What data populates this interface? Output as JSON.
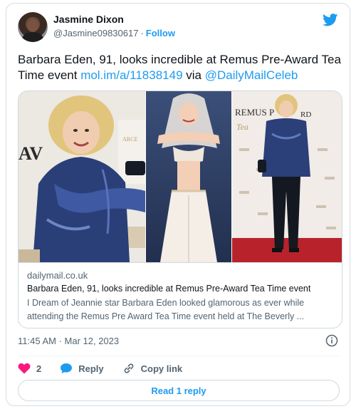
{
  "user": {
    "name": "Jasmine Dixon",
    "handle": "@Jasmine09830617",
    "follow_label": "Follow"
  },
  "tweet": {
    "text_plain": "Barbara Eden, 91, looks incredible at Remus Pre-Award Tea Time event ",
    "link_url": "mol.im/a/11838149",
    "via_text": " via ",
    "mention": "@DailyMailCeleb"
  },
  "card": {
    "domain": "dailymail.co.uk",
    "title": "Barbara Eden, 91, looks incredible at Remus Pre-Award Tea Time event",
    "description": "I Dream of Jeannie star Barbara Eden looked glamorous as ever while attending the Remus Pre Award Tea Time event held at The Beverly ...",
    "backdrop_text_1": "ARCE",
    "backdrop_text_2": "REMUS P",
    "backdrop_text_3": "RD",
    "backdrop_text_4": "Tea"
  },
  "meta": {
    "timestamp": "11:45 AM · Mar 12, 2023"
  },
  "actions": {
    "like_count": "2",
    "reply_label": "Reply",
    "copy_link_label": "Copy link",
    "read_replies_label": "Read 1 reply"
  },
  "colors": {
    "accent": "#1d9bf0",
    "like": "#f91880",
    "reply_bubble": "#1d9bf0"
  },
  "icons": {
    "brand": "twitter-bird-icon",
    "info": "info-icon",
    "like": "heart-icon",
    "reply": "speech-bubble-icon",
    "copy_link": "link-icon"
  }
}
